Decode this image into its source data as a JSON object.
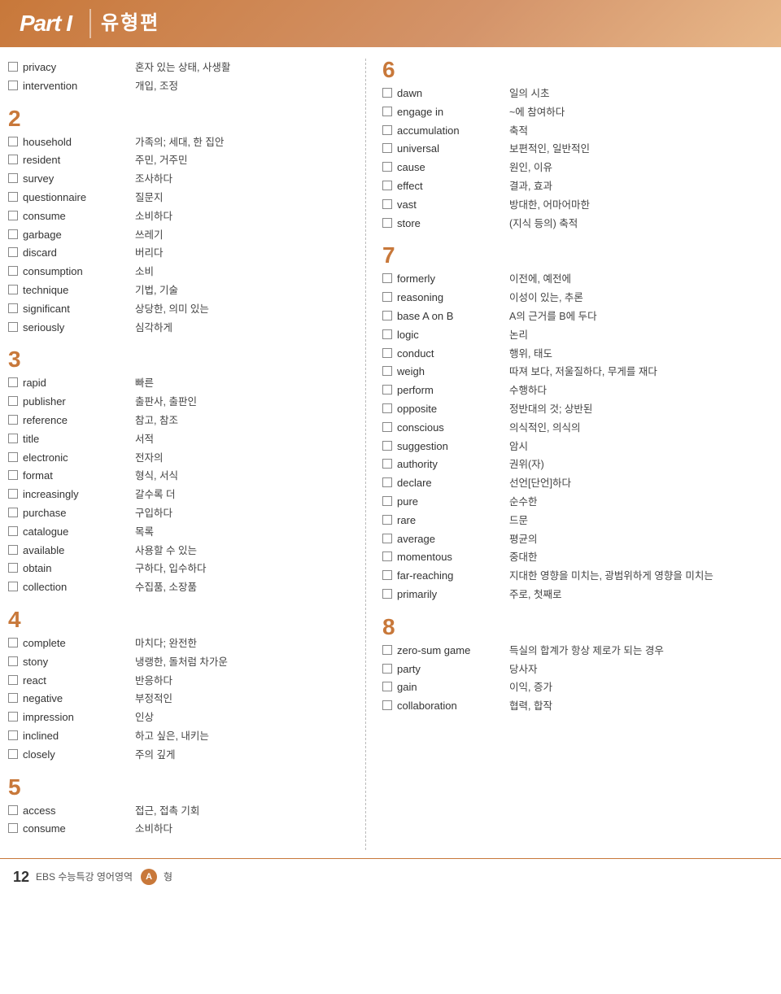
{
  "header": {
    "part_label": "Part I",
    "title_korean": "유형편"
  },
  "footer": {
    "page_number": "12",
    "text": "EBS 수능특강 영어영역",
    "badge": "A",
    "suffix": "형"
  },
  "left_column": {
    "sections": [
      {
        "num": "2",
        "words": [
          {
            "en": "household",
            "kr": "가족의; 세대, 한 집안"
          },
          {
            "en": "resident",
            "kr": "주민, 거주민"
          },
          {
            "en": "survey",
            "kr": "조사하다"
          },
          {
            "en": "questionnaire",
            "kr": "질문지"
          },
          {
            "en": "consume",
            "kr": "소비하다"
          },
          {
            "en": "garbage",
            "kr": "쓰레기"
          },
          {
            "en": "discard",
            "kr": "버리다"
          },
          {
            "en": "consumption",
            "kr": "소비"
          },
          {
            "en": "technique",
            "kr": "기법, 기술"
          },
          {
            "en": "significant",
            "kr": "상당한, 의미 있는"
          },
          {
            "en": "seriously",
            "kr": "심각하게"
          }
        ]
      },
      {
        "num": "3",
        "words": [
          {
            "en": "rapid",
            "kr": "빠른"
          },
          {
            "en": "publisher",
            "kr": "출판사, 출판인"
          },
          {
            "en": "reference",
            "kr": "참고, 참조"
          },
          {
            "en": "title",
            "kr": "서적"
          },
          {
            "en": "electronic",
            "kr": "전자의"
          },
          {
            "en": "format",
            "kr": "형식, 서식"
          },
          {
            "en": "increasingly",
            "kr": "갈수록 더"
          },
          {
            "en": "purchase",
            "kr": "구입하다"
          },
          {
            "en": "catalogue",
            "kr": "목록"
          },
          {
            "en": "available",
            "kr": "사용할 수 있는"
          },
          {
            "en": "obtain",
            "kr": "구하다, 입수하다"
          },
          {
            "en": "collection",
            "kr": "수집품, 소장품"
          }
        ]
      },
      {
        "num": "4",
        "words": [
          {
            "en": "complete",
            "kr": "마치다; 완전한"
          },
          {
            "en": "stony",
            "kr": "냉랭한, 돌처럼 차가운"
          },
          {
            "en": "react",
            "kr": "반응하다"
          },
          {
            "en": "negative",
            "kr": "부정적인"
          },
          {
            "en": "impression",
            "kr": "인상"
          },
          {
            "en": "inclined",
            "kr": "하고 싶은, 내키는"
          },
          {
            "en": "closely",
            "kr": "주의 깊게"
          }
        ]
      },
      {
        "num": "5",
        "words": [
          {
            "en": "access",
            "kr": "접근, 접촉 기회"
          },
          {
            "en": "consume",
            "kr": "소비하다"
          }
        ]
      }
    ],
    "top_words": [
      {
        "en": "privacy",
        "kr": "혼자 있는 상태, 사생활"
      },
      {
        "en": "intervention",
        "kr": "개입, 조정"
      }
    ]
  },
  "right_column": {
    "sections": [
      {
        "num": "6",
        "words": [
          {
            "en": "dawn",
            "kr": "일의 시초"
          },
          {
            "en": "engage in",
            "kr": "~에 참여하다"
          },
          {
            "en": "accumulation",
            "kr": "축적"
          },
          {
            "en": "universal",
            "kr": "보편적인, 일반적인"
          },
          {
            "en": "cause",
            "kr": "원인, 이유"
          },
          {
            "en": "effect",
            "kr": "결과, 효과"
          },
          {
            "en": "vast",
            "kr": "방대한, 어마어마한"
          },
          {
            "en": "store",
            "kr": "(지식 등의) 축적"
          }
        ]
      },
      {
        "num": "7",
        "words": [
          {
            "en": "formerly",
            "kr": "이전에, 예전에"
          },
          {
            "en": "reasoning",
            "kr": "이성이 있는, 추론"
          },
          {
            "en": "base A on B",
            "kr": "A의 근거를 B에 두다"
          },
          {
            "en": "logic",
            "kr": "논리"
          },
          {
            "en": "conduct",
            "kr": "행위, 태도"
          },
          {
            "en": "weigh",
            "kr": "따져 보다, 저울질하다, 무게를 재다"
          },
          {
            "en": "perform",
            "kr": "수행하다"
          },
          {
            "en": "opposite",
            "kr": "정반대의 것; 상반된"
          },
          {
            "en": "conscious",
            "kr": "의식적인, 의식의"
          },
          {
            "en": "suggestion",
            "kr": "암시"
          },
          {
            "en": "authority",
            "kr": "권위(자)"
          },
          {
            "en": "declare",
            "kr": "선언[단언]하다"
          },
          {
            "en": "pure",
            "kr": "순수한"
          },
          {
            "en": "rare",
            "kr": "드문"
          },
          {
            "en": "average",
            "kr": "평균의"
          },
          {
            "en": "momentous",
            "kr": "중대한"
          },
          {
            "en": "far-reaching",
            "kr": "지대한 영향을 미치는, 광범위하게 영향을 미치는"
          },
          {
            "en": "primarily",
            "kr": "주로, 첫째로"
          }
        ]
      },
      {
        "num": "8",
        "words": [
          {
            "en": "zero-sum game",
            "kr": "득실의 합계가 항상 제로가 되는 경우"
          },
          {
            "en": "party",
            "kr": "당사자"
          },
          {
            "en": "gain",
            "kr": "이익, 증가"
          },
          {
            "en": "collaboration",
            "kr": "협력, 합작"
          }
        ]
      }
    ]
  }
}
